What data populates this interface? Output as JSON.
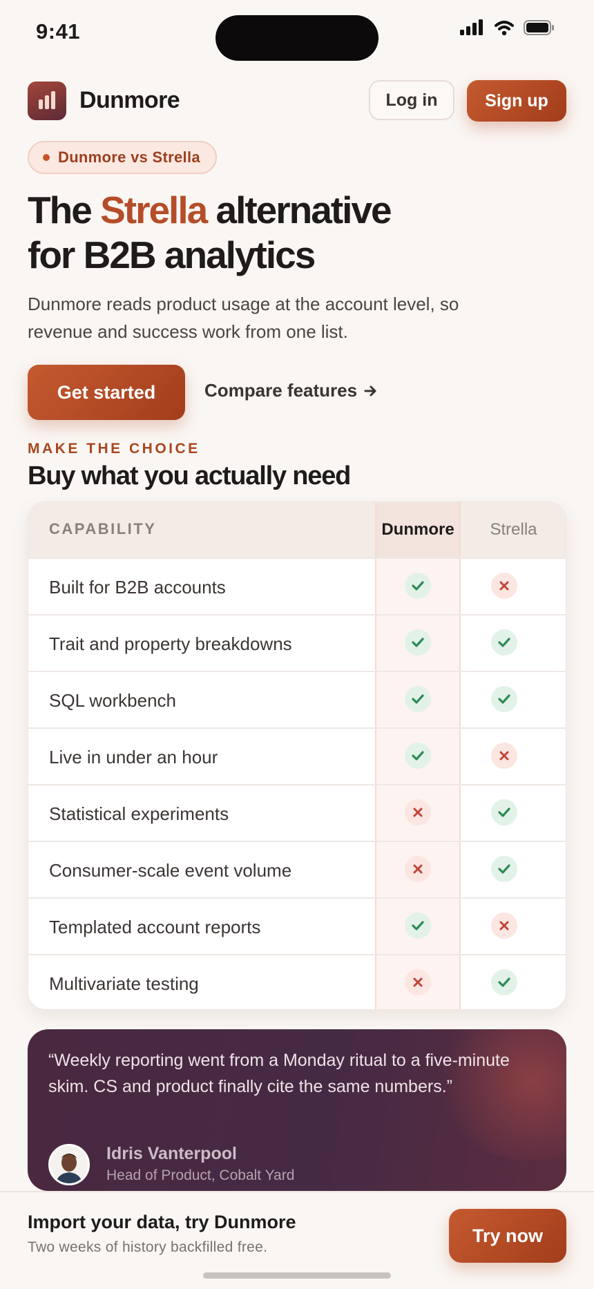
{
  "status_bar": {
    "time": "9:41"
  },
  "header": {
    "brand": "Dunmore",
    "login_label": "Log in",
    "signup_label": "Sign up"
  },
  "hero": {
    "pill": "Dunmore vs Strella",
    "title_pre": "The ",
    "title_accent": "Strella",
    "title_post": " alternative",
    "title_line2": "for B2B analytics",
    "subtitle": "Dunmore reads product usage at the account level, so revenue and success work from one list.",
    "cta_primary": "Get started",
    "cta_secondary": "Compare features"
  },
  "comparison": {
    "eyebrow": "MAKE THE CHOICE",
    "title": "Buy what you actually need",
    "headers": {
      "capability": "CAPABILITY",
      "ours": "Dunmore",
      "theirs": "Strella"
    },
    "rows": [
      {
        "label": "Built for B2B accounts",
        "dunmore": true,
        "strella": false
      },
      {
        "label": "Trait and property breakdowns",
        "dunmore": true,
        "strella": true
      },
      {
        "label": "SQL workbench",
        "dunmore": true,
        "strella": true
      },
      {
        "label": "Live in under an hour",
        "dunmore": true,
        "strella": false
      },
      {
        "label": "Statistical experiments",
        "dunmore": false,
        "strella": true
      },
      {
        "label": "Consumer-scale event volume",
        "dunmore": false,
        "strella": true
      },
      {
        "label": "Templated account reports",
        "dunmore": true,
        "strella": false
      },
      {
        "label": "Multivariate testing",
        "dunmore": false,
        "strella": true
      }
    ]
  },
  "testimonial": {
    "quote": "“Weekly reporting went from a Monday ritual to a five-minute skim. CS and product finally cite the same numbers.”",
    "name": "Idris Vanterpool",
    "role": "Head of Product, Cobalt Yard"
  },
  "bottom_bar": {
    "title": "Import your data, try Dunmore",
    "subtitle": "Two weeks of history backfilled free.",
    "cta": "Try now"
  },
  "colors": {
    "accent": "#b44d28",
    "check": "#2f8a55",
    "cross": "#c0443a"
  },
  "icons": {
    "check": "check-icon",
    "cross": "cross-icon",
    "arrow": "arrow-right-icon",
    "logo": "bar-chart-logo-icon"
  }
}
